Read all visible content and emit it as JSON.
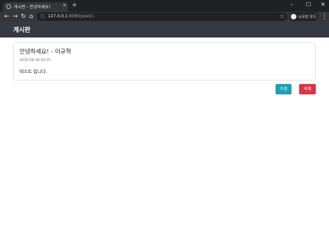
{
  "browser": {
    "tab_title": "게시판 - 안녕하세요!",
    "tab_close": "✕",
    "new_tab": "+",
    "url_host": "127.0.0.1",
    "url_path": ":8080/post/1",
    "profile_label": "시크릿 모드",
    "icons": {
      "back": "←",
      "forward": "→",
      "reload": "↻",
      "home": "⌂",
      "info": "ⓘ",
      "star": "☆",
      "menu": "⋮",
      "minimize": "–",
      "maximize": "☐",
      "close": "✕"
    }
  },
  "navbar": {
    "brand": "게시판"
  },
  "post": {
    "title": "안녕하세요! - 이규혁",
    "date": "2020-08-16 02:07",
    "content": "테스트 입니다."
  },
  "actions": {
    "edit_label": "수정",
    "delete_label": "삭제"
  },
  "colors": {
    "navbar": "#343a40",
    "edit": "#17a2b8",
    "delete": "#dc3545"
  }
}
